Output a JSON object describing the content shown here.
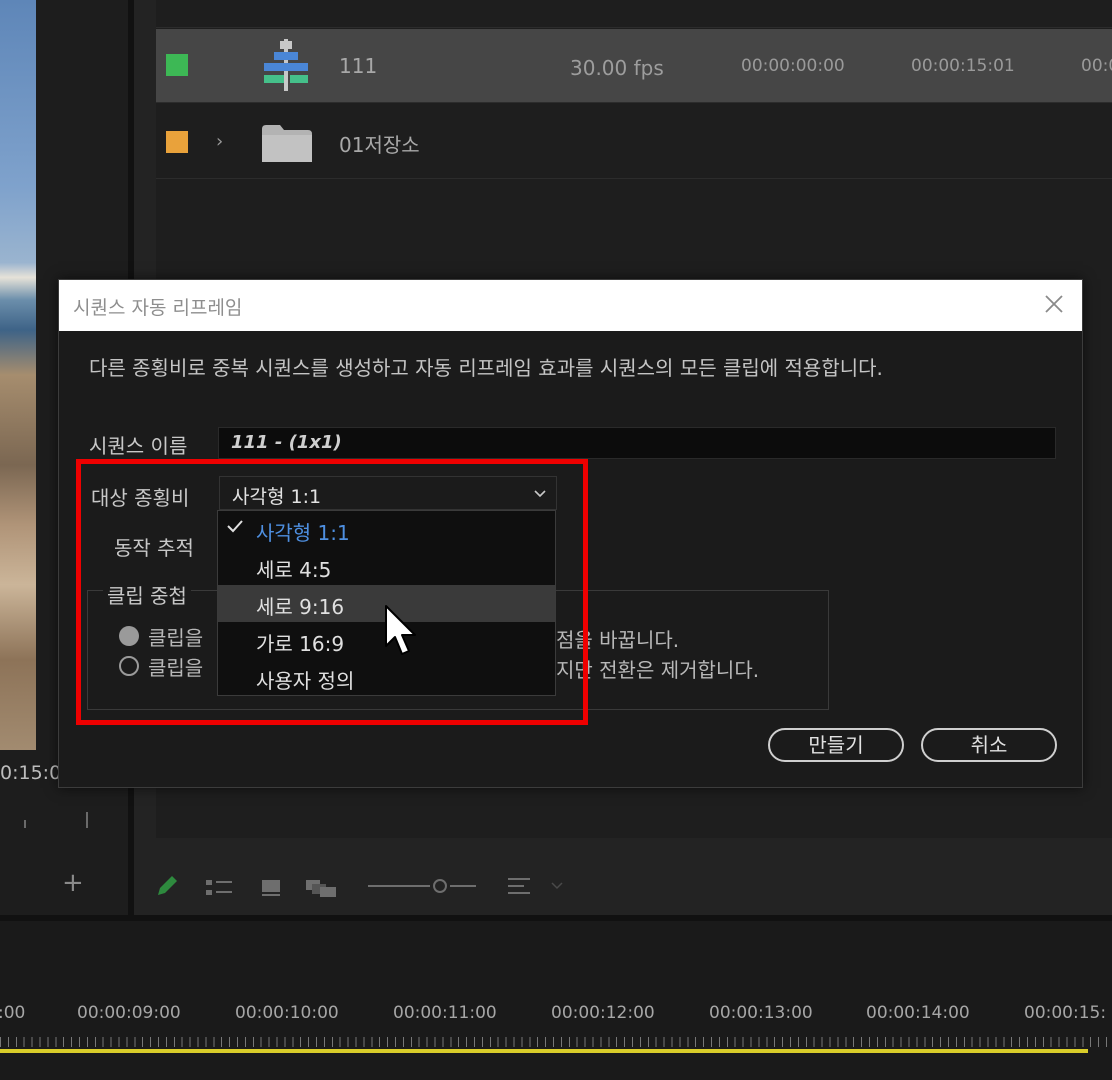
{
  "preview": {
    "timecode": "0:15:0"
  },
  "project": {
    "rows": [
      {
        "name": "111",
        "fps": "30.00 fps",
        "start": "00:00:00:00",
        "end": "00:00:15:01",
        "extra": "00:0",
        "color": "#3db855"
      },
      {
        "name": "01저장소",
        "color": "#e9a23b"
      }
    ]
  },
  "dialog": {
    "title": "시퀀스 자동 리프레임",
    "description": "다른 종횡비로 중복 시퀀스를 생성하고 자동 리프레임 효과를 시퀀스의 모든 클립에 적용합니다.",
    "sequence_name_label": "시퀀스 이름",
    "sequence_name_value": "111 - (1x1)",
    "aspect_label": "대상 종횡비",
    "aspect_value": "사각형 1:1",
    "motion_label": "동작 추적",
    "clip_nesting_label": "클립 중첩",
    "radio1_left": "클립을",
    "radio1_right": "점을 바꿉니다.",
    "radio2_left": "클립을",
    "radio2_right": "지만 전환은 제거합니다.",
    "create_button": "만들기",
    "cancel_button": "취소"
  },
  "dropdown": {
    "items": [
      {
        "label": "사각형 1:1",
        "selected": true
      },
      {
        "label": "세로 4:5"
      },
      {
        "label": "세로 9:16",
        "hover": true
      },
      {
        "label": "가로 16:9"
      },
      {
        "label": "사용자 정의"
      }
    ]
  },
  "timeline": {
    "labels": [
      ":00",
      "00:00:09:00",
      "00:00:10:00",
      "00:00:11:00",
      "00:00:12:00",
      "00:00:13:00",
      "00:00:14:00",
      "00:00:15:"
    ]
  },
  "colors": {
    "highlight": "#ee0000",
    "accent_selected": "#4e8fe0",
    "workbar": "#d9cd2a"
  }
}
